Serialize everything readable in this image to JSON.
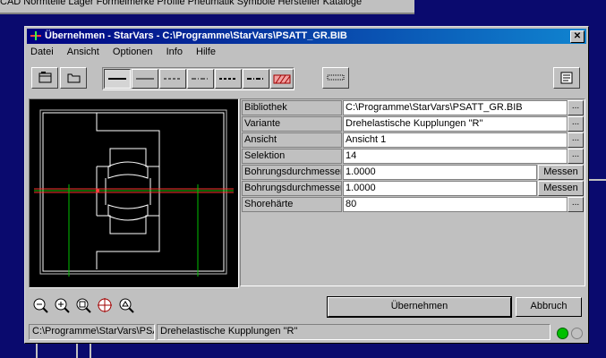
{
  "background": {
    "menu_text": "CAD   Normteile   Lager   Formelmerke   Profile   Pneumatik Symbole   Hersteller Kataloge"
  },
  "window": {
    "title": "Übernehmen - StarVars - C:\\Programme\\StarVars\\PSATT_GR.BIB",
    "close_symbol": "✕"
  },
  "menu": [
    "Datei",
    "Ansicht",
    "Optionen",
    "Info",
    "Hilfe"
  ],
  "toolbar": {
    "buttons": [
      {
        "name": "open-library-icon"
      },
      {
        "name": "folder-icon"
      },
      {
        "name": "line-thick-icon"
      },
      {
        "name": "line-thin-icon"
      },
      {
        "name": "line-dashed-icon"
      },
      {
        "name": "line-dashdot-icon"
      },
      {
        "name": "line-dashed-bold-icon"
      },
      {
        "name": "line-dashdot-bold-icon"
      },
      {
        "name": "hatch-icon"
      },
      {
        "name": "dotted-line-icon"
      },
      {
        "name": "properties-icon"
      }
    ]
  },
  "properties": [
    {
      "label": "Bibliothek",
      "value": "C:\\Programme\\StarVars\\PSATT_GR.BIB",
      "button": "..."
    },
    {
      "label": "Variante",
      "value": "Drehelastische Kupplungen \"R\"",
      "button": "..."
    },
    {
      "label": "Ansicht",
      "value": "Ansicht 1",
      "button": "..."
    },
    {
      "label": "Selektion",
      "value": "14",
      "button": "..."
    },
    {
      "label": "Bohrungsdurchmesser",
      "value": "1.0000",
      "button": "Messen"
    },
    {
      "label": "Bohrungsdurchmesser",
      "value": "1.0000",
      "button": "Messen"
    },
    {
      "label": "Shorehärte",
      "value": "80",
      "button": "..."
    }
  ],
  "zoom_tools": [
    "zoom-out-icon",
    "zoom-in-icon",
    "zoom-window-icon",
    "zoom-center-icon",
    "zoom-fit-icon"
  ],
  "actions": {
    "apply": "Übernehmen",
    "cancel": "Abbruch"
  },
  "status": {
    "path": "C:\\Programme\\StarVars\\PSATT_GR.BIB",
    "variant": "Drehelastische Kupplungen \"R\"",
    "led1_color": "#00c000",
    "led2_color": "#c0c0c0"
  }
}
